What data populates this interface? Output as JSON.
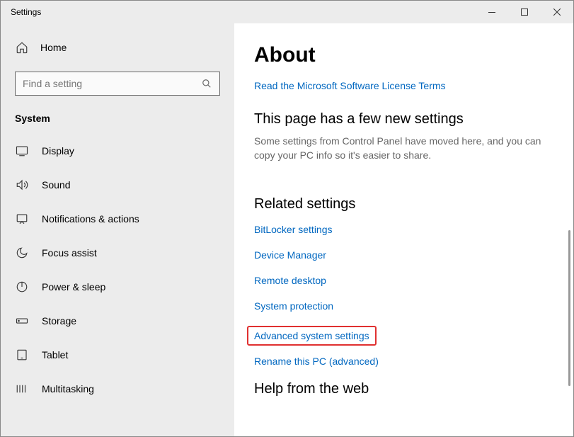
{
  "titlebar": {
    "label": "Settings"
  },
  "sidebar": {
    "home": "Home",
    "search_placeholder": "Find a setting",
    "section": "System",
    "items": [
      {
        "label": "Display"
      },
      {
        "label": "Sound"
      },
      {
        "label": "Notifications & actions"
      },
      {
        "label": "Focus assist"
      },
      {
        "label": "Power & sleep"
      },
      {
        "label": "Storage"
      },
      {
        "label": "Tablet"
      },
      {
        "label": "Multitasking"
      }
    ]
  },
  "content": {
    "title": "About",
    "license_link": "Read the Microsoft Software License Terms",
    "new_settings_head": "This page has a few new settings",
    "new_settings_desc": "Some settings from Control Panel have moved here, and you can copy your PC info so it's easier to share.",
    "related_head": "Related settings",
    "related_links": {
      "bitlocker": "BitLocker settings",
      "device_manager": "Device Manager",
      "remote_desktop": "Remote desktop",
      "system_protection": "System protection",
      "advanced_system": "Advanced system settings",
      "rename_pc": "Rename this PC (advanced)"
    },
    "help_head": "Help from the web"
  }
}
